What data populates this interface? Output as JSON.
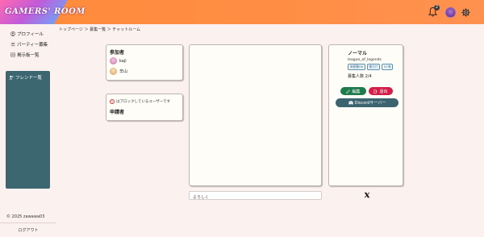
{
  "header": {
    "logo_text": "GAMERS' ROOM",
    "notification_count": "2",
    "colors": {
      "bar": "#ff8a3a",
      "logo_gradient": [
        "#ff6ab0",
        "#c15bd9",
        "#5bb7ff"
      ]
    },
    "icons": [
      "bell-icon",
      "avatar",
      "gear-icon"
    ]
  },
  "sidebar": {
    "items": [
      {
        "label": "プロフィール",
        "icon": "user-circle-icon"
      },
      {
        "label": "パーティー募集",
        "icon": "group-icon"
      },
      {
        "label": "掲示板一覧",
        "icon": "board-icon"
      }
    ],
    "friends_title": "フレンド一覧",
    "friends_icon": "user-plus-icon",
    "copyright": "© 2025 zawawa03",
    "logout_label": "ログアウト"
  },
  "breadcrumb": "トップページ ＞ 募集一覧 ＞ チャットルーム",
  "participants": {
    "title": "参加者",
    "members": [
      {
        "name": "kaji",
        "avatar_color": "#e9a3c9"
      },
      {
        "name": "辛山",
        "avatar_color": "#f0c48a"
      }
    ]
  },
  "applicants": {
    "warning": "はブロックしているユーザーです",
    "title": "申請者"
  },
  "chat": {
    "input_placeholder": "よろしく"
  },
  "party_info": {
    "mode": "ノーマル",
    "game": "league_of_legends",
    "tags": [
      "未経験OK",
      "夜だけ",
      "VC有"
    ],
    "recruit_label": "募集人数",
    "recruit_value": "2/4",
    "edit_label": "編集",
    "delete_label": "退出",
    "discord_label": "Discordサーバー",
    "colors": {
      "edit": "#1f7a4c",
      "delete": "#d41e4a",
      "discord": "#3b6470"
    }
  },
  "share": {
    "icon": "x-logo-icon"
  }
}
